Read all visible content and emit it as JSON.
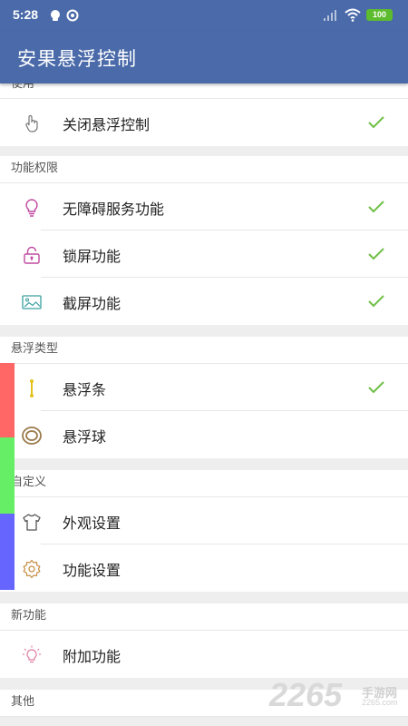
{
  "status_bar": {
    "time": "5:28",
    "battery": "100"
  },
  "app_bar": {
    "title": "安果悬浮控制"
  },
  "sections": {
    "use": {
      "title": "使用",
      "items": [
        {
          "label": "关闭悬浮控制",
          "icon": "hand-pointer-icon",
          "checked": true
        }
      ]
    },
    "permissions": {
      "title": "功能权限",
      "items": [
        {
          "label": "无障碍服务功能",
          "icon": "lightbulb-icon",
          "checked": true
        },
        {
          "label": "锁屏功能",
          "icon": "lock-icon",
          "checked": true
        },
        {
          "label": "截屏功能",
          "icon": "screenshot-icon",
          "checked": true
        }
      ]
    },
    "float_type": {
      "title": "悬浮类型",
      "items": [
        {
          "label": "悬浮条",
          "icon": "float-bar-icon",
          "checked": true
        },
        {
          "label": "悬浮球",
          "icon": "float-ball-icon",
          "checked": false
        }
      ]
    },
    "custom": {
      "title": "自定义",
      "items": [
        {
          "label": "外观设置",
          "icon": "tshirt-icon"
        },
        {
          "label": "功能设置",
          "icon": "gear-icon"
        }
      ]
    },
    "new_features": {
      "title": "新功能",
      "items": [
        {
          "label": "附加功能",
          "icon": "bulb-outline-icon"
        }
      ]
    },
    "other": {
      "title": "其他"
    }
  },
  "colors": {
    "primary": "#4a6aa9",
    "check": "#6fbf45",
    "edge_bar": [
      "#ff6666",
      "#66ee66",
      "#6666ff"
    ]
  },
  "watermark": {
    "number": "2265",
    "cn": "手游网",
    "url": "2265.com"
  }
}
